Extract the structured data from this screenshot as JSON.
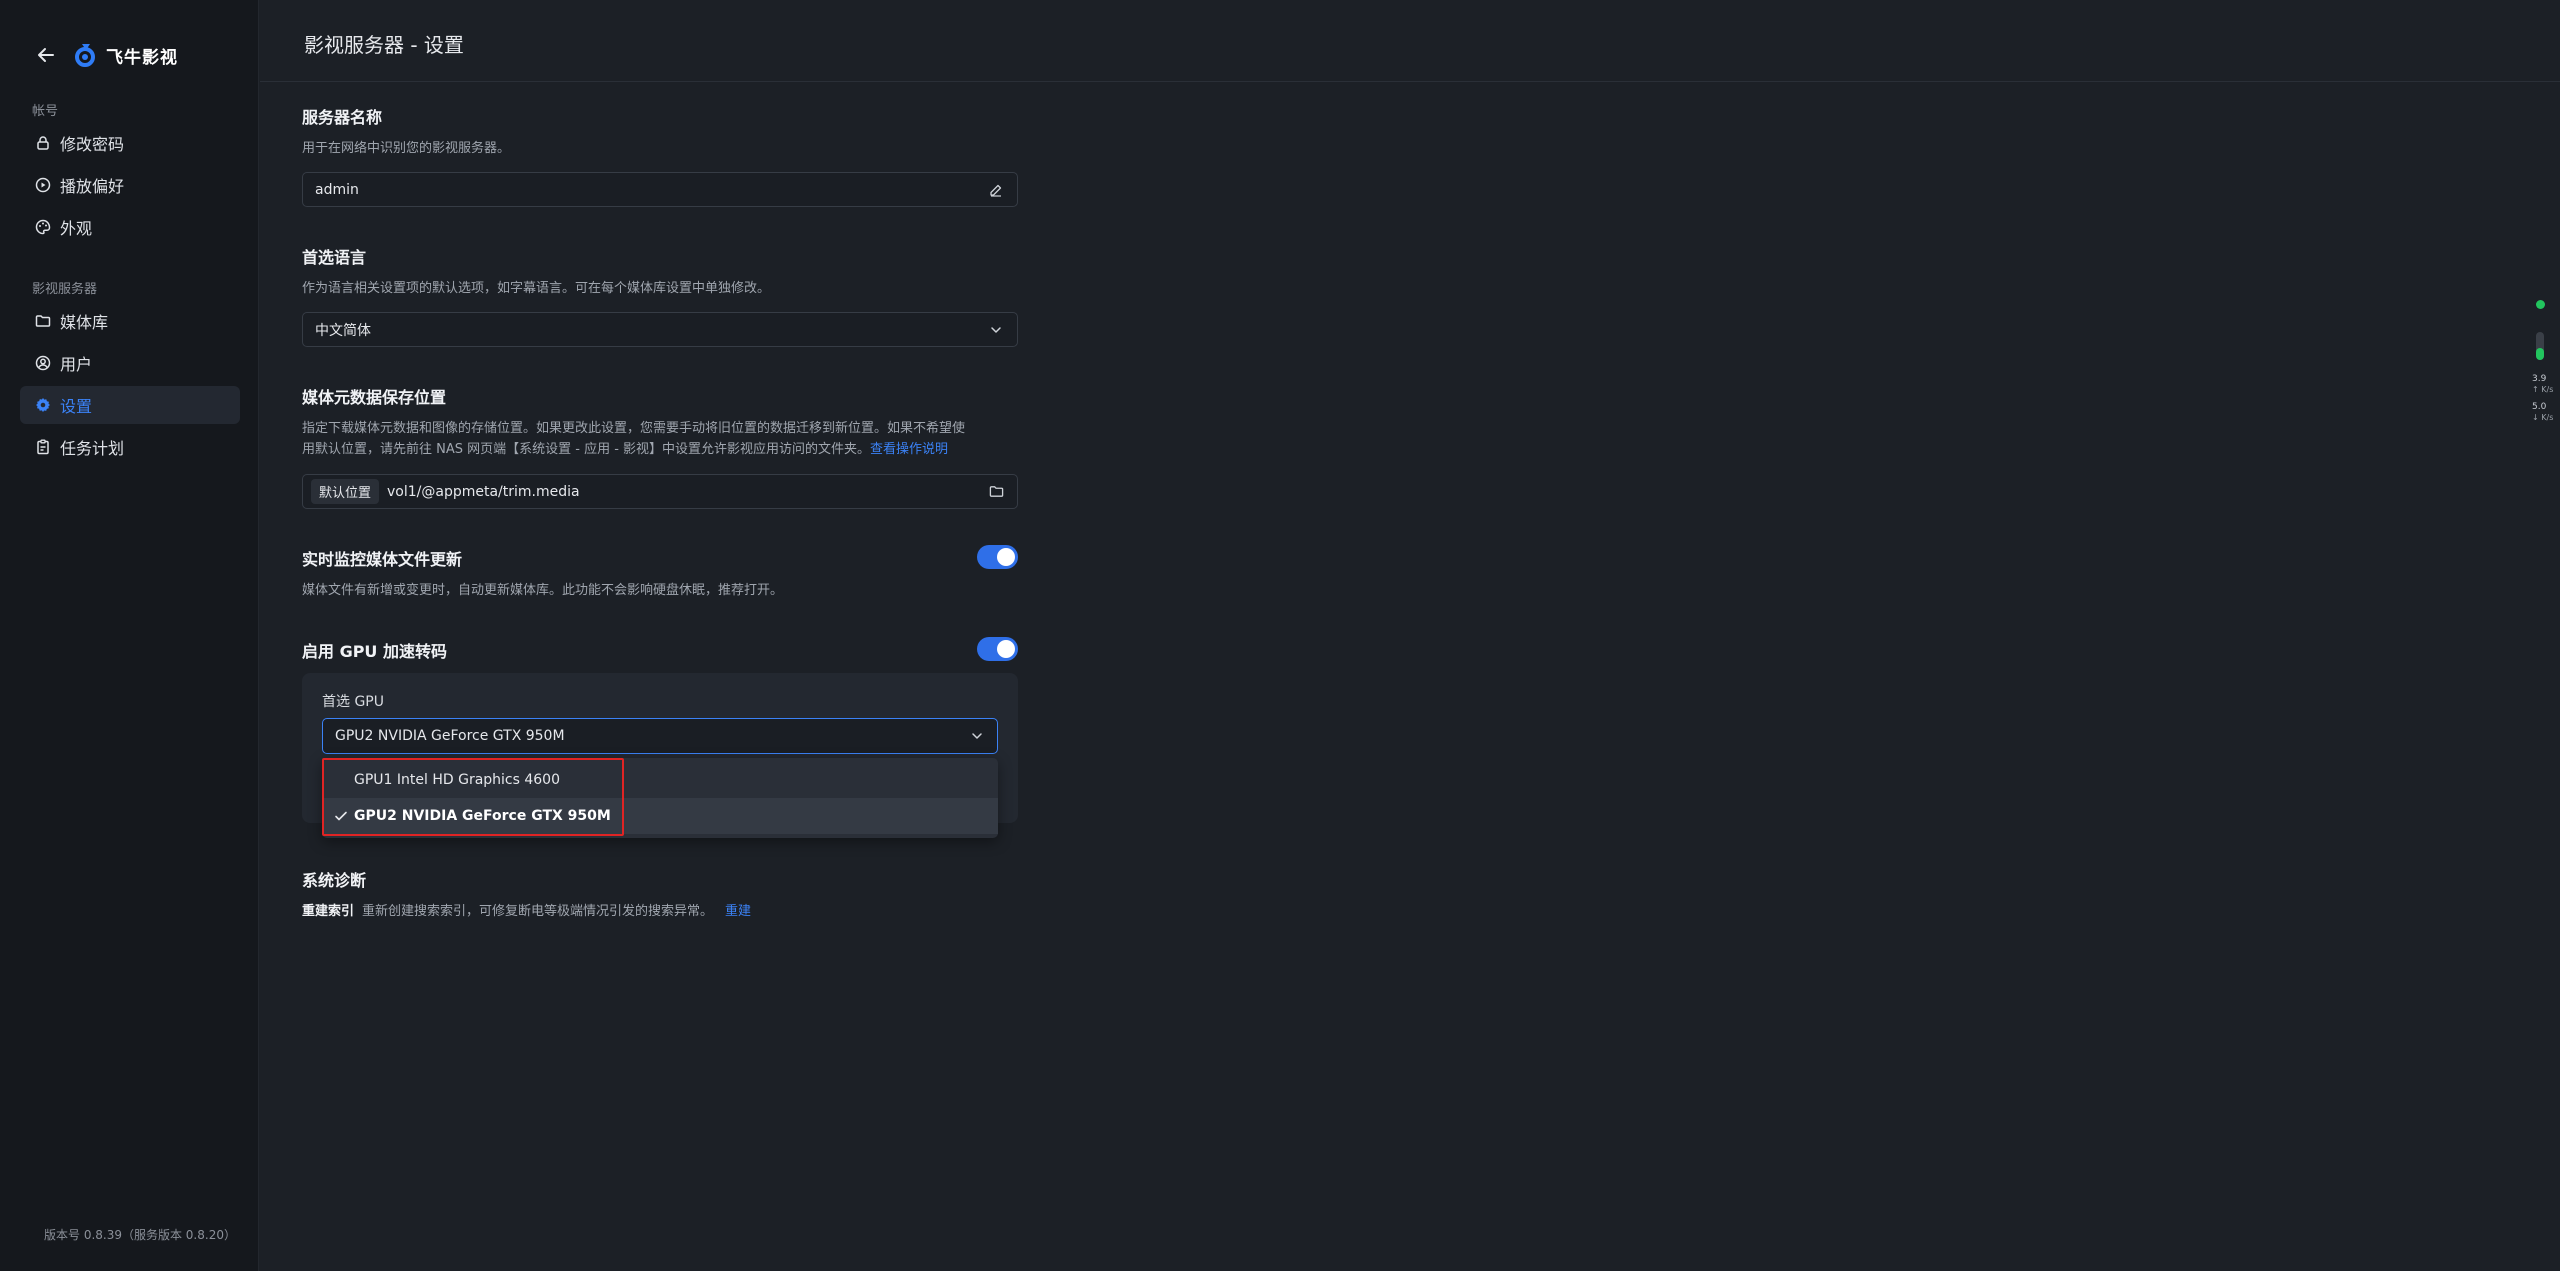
{
  "app": {
    "name": "飞牛影视",
    "version": "版本号 0.8.39（服务版本 0.8.20）"
  },
  "sidebar": {
    "groups": [
      {
        "label": "帐号",
        "items": [
          {
            "label": "修改密码",
            "icon": "lock-icon"
          },
          {
            "label": "播放偏好",
            "icon": "play-circle-icon"
          },
          {
            "label": "外观",
            "icon": "palette-icon"
          }
        ]
      },
      {
        "label": "影视服务器",
        "items": [
          {
            "label": "媒体库",
            "icon": "folder-icon"
          },
          {
            "label": "用户",
            "icon": "user-icon"
          },
          {
            "label": "设置",
            "icon": "gear-icon",
            "active": true
          },
          {
            "label": "任务计划",
            "icon": "clipboard-icon"
          }
        ]
      }
    ]
  },
  "header": {
    "title": "影视服务器 - 设置"
  },
  "settings": {
    "server_name": {
      "title": "服务器名称",
      "desc": "用于在网络中识别您的影视服务器。",
      "value": "admin"
    },
    "language": {
      "title": "首选语言",
      "desc": "作为语言相关设置项的默认选项，如字幕语言。可在每个媒体库设置中单独修改。",
      "value": "中文简体"
    },
    "metadata": {
      "title": "媒体元数据保存位置",
      "desc1": "指定下载媒体元数据和图像的存储位置。如果更改此设置，您需要手动将旧位置的数据迁移到新位置。如果不希望使",
      "desc2": "用默认位置，请先前往 NAS 网页端【系统设置 - 应用 - 影视】中设置允许影视应用访问的文件夹。",
      "link": "查看操作说明",
      "tag": "默认位置",
      "path": "vol1/@appmeta/trim.media"
    },
    "monitor": {
      "title": "实时监控媒体文件更新",
      "desc": "媒体文件有新增或变更时，自动更新媒体库。此功能不会影响硬盘休眠，推荐打开。",
      "enabled": true
    },
    "gpu": {
      "title": "启用 GPU 加速转码",
      "enabled": true,
      "preferred_label": "首选 GPU",
      "selected": "GPU2 NVIDIA GeForce GTX 950M",
      "options": [
        "GPU1 Intel HD Graphics 4600",
        "GPU2 NVIDIA GeForce GTX 950M"
      ]
    },
    "diagnostics": {
      "title": "系统诊断",
      "item": "重建索引",
      "desc": "重新创建搜索索引，可修复断电等极端情况引发的搜索异常。",
      "action": "重建"
    }
  },
  "net_widget": {
    "up": "3.9",
    "up_unit": "K/s",
    "down": "5.0",
    "down_unit": "K/s",
    "color": "#22c55e"
  },
  "colors": {
    "accent": "#3b82f6",
    "highlight": "#e02424"
  }
}
